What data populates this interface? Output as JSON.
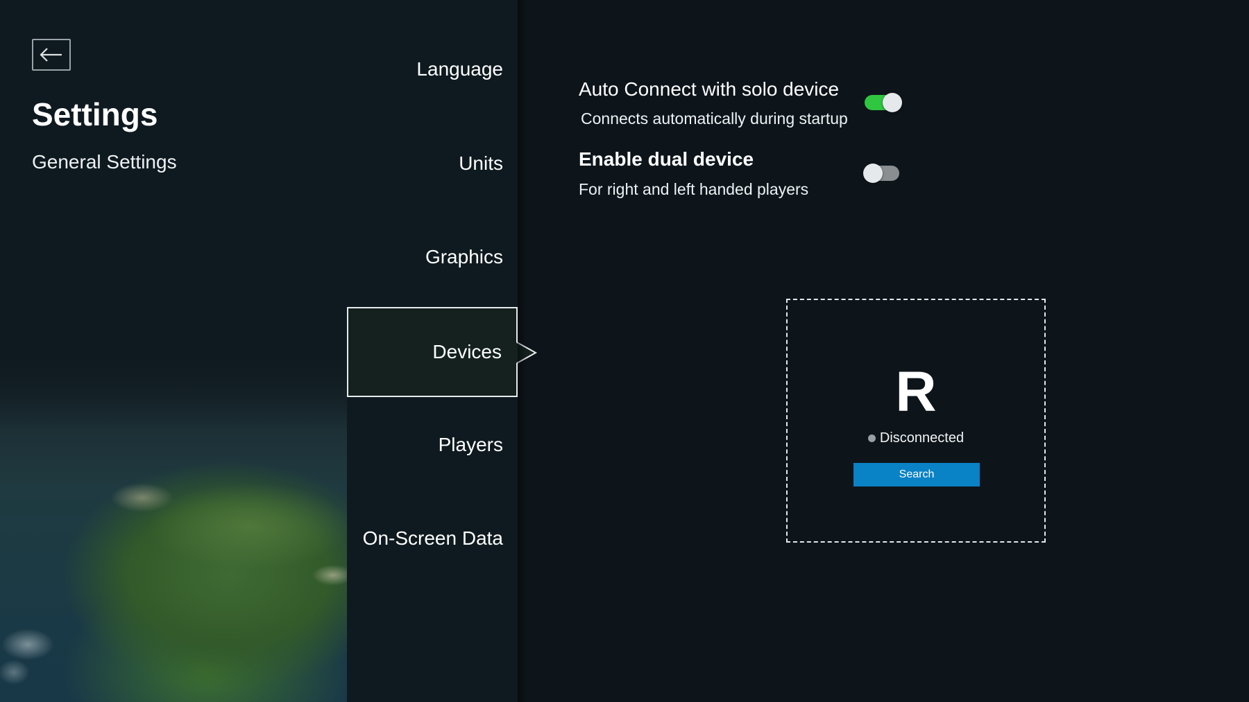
{
  "header": {
    "back_icon": "arrow-left-icon",
    "title": "Settings",
    "subtitle": "General Settings"
  },
  "nav": {
    "items": [
      {
        "label": "Language"
      },
      {
        "label": "Units"
      },
      {
        "label": "Graphics"
      },
      {
        "label": "Devices",
        "selected": true
      },
      {
        "label": "Players"
      },
      {
        "label": "On-Screen Data"
      }
    ]
  },
  "settings": {
    "auto_connect": {
      "title": "Auto Connect with solo device",
      "description": "Connects automatically during startup",
      "enabled": true
    },
    "dual_device": {
      "title": "Enable dual device",
      "description": "For right and left handed players",
      "enabled": false
    }
  },
  "device": {
    "letter": "R",
    "status": "Disconnected",
    "search_label": "Search"
  },
  "colors": {
    "background": "#0d151b",
    "toggle_on": "#2fc640",
    "toggle_off": "#8a8e91",
    "button": "#0a82c6",
    "status_dot": "#9a9fa3"
  }
}
